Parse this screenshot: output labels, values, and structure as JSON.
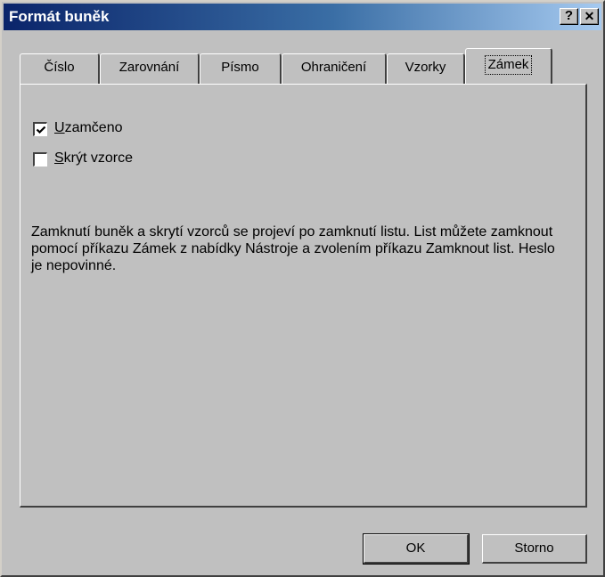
{
  "window": {
    "title": "Formát buněk",
    "help_label": "?",
    "close_label": "✕"
  },
  "tabs": [
    {
      "label": "Číslo",
      "active": false
    },
    {
      "label": "Zarovnání",
      "active": false
    },
    {
      "label": "Písmo",
      "active": false
    },
    {
      "label": "Ohraničení",
      "active": false
    },
    {
      "label": "Vzorky",
      "active": false
    },
    {
      "label": "Zámek",
      "active": true
    }
  ],
  "options": {
    "locked": {
      "accel": "U",
      "rest": "zamčeno",
      "checked": true
    },
    "hide_formulas": {
      "accel": "S",
      "rest": "krýt vzorce",
      "checked": false
    }
  },
  "description": "Zamknutí buněk a skrytí vzorců se projeví po zamknutí listu. List můžete zamknout pomocí příkazu Zámek z nabídky Nástroje a zvolením příkazu Zamknout list. Heslo je nepovinné.",
  "buttons": {
    "ok_label": "OK",
    "cancel_label": "Storno"
  }
}
